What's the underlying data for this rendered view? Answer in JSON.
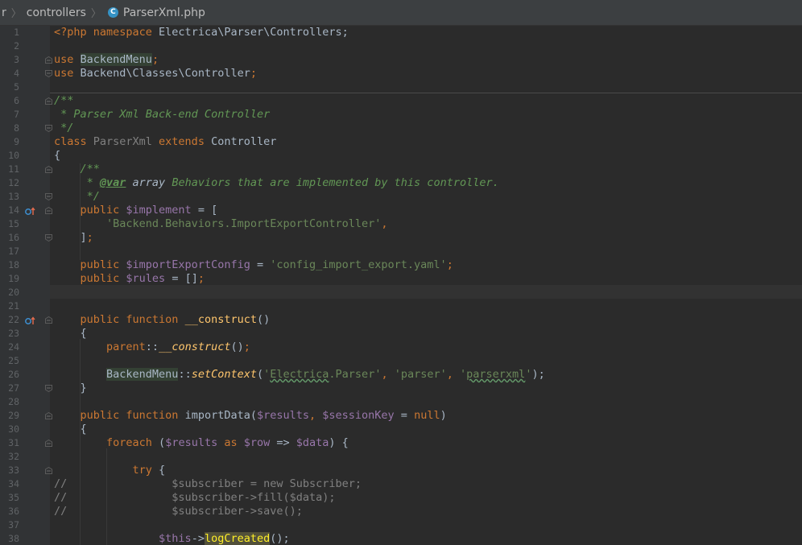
{
  "breadcrumb": {
    "partial": "r",
    "folder": "controllers",
    "file": "ParserXml.php",
    "file_icon_letter": "C"
  },
  "lines": [
    {
      "n": "1"
    },
    {
      "n": "2"
    },
    {
      "n": "3"
    },
    {
      "n": "4"
    },
    {
      "n": "5"
    },
    {
      "n": "6"
    },
    {
      "n": "7"
    },
    {
      "n": "8"
    },
    {
      "n": "9"
    },
    {
      "n": "10"
    },
    {
      "n": "11"
    },
    {
      "n": "12"
    },
    {
      "n": "13"
    },
    {
      "n": "14"
    },
    {
      "n": "15"
    },
    {
      "n": "16"
    },
    {
      "n": "17"
    },
    {
      "n": "18"
    },
    {
      "n": "19"
    },
    {
      "n": "20"
    },
    {
      "n": "21"
    },
    {
      "n": "22"
    },
    {
      "n": "23"
    },
    {
      "n": "24"
    },
    {
      "n": "25"
    },
    {
      "n": "26"
    },
    {
      "n": "27"
    },
    {
      "n": "28"
    },
    {
      "n": "29"
    },
    {
      "n": "30"
    },
    {
      "n": "31"
    },
    {
      "n": "32"
    },
    {
      "n": "33"
    },
    {
      "n": "34"
    },
    {
      "n": "35"
    },
    {
      "n": "36"
    },
    {
      "n": "37"
    },
    {
      "n": "38"
    }
  ],
  "tokens": {
    "l1_a": "<?php namespace",
    "l1_b": " Electrica\\Parser\\Controllers;",
    "l3_a": "use",
    "l3_b": "BackendMenu",
    "l3_c": ";",
    "l4_a": "use",
    "l4_b": " Backend\\Classes\\Controller",
    "l4_c": ";",
    "l6": "/**",
    "l7": " * Parser Xml Back-end Controller",
    "l8": " */",
    "l9_a": "class",
    "l9_b": " ParserXml ",
    "l9_c": "extends",
    "l9_d": " Controller",
    "l10": "{",
    "l11": "    /**",
    "l12_a": "     * ",
    "l12_b": "@var",
    "l12_c": " array",
    "l12_d": " Behaviors that are implemented by this controller.",
    "l13": "     */",
    "l14_a": "    public ",
    "l14_b": "$implement",
    "l14_c": " = [",
    "l15": "        'Backend.Behaviors.ImportExportController'",
    "l15_b": ",",
    "l16_a": "    ]",
    "l16_b": ";",
    "l18_a": "    public ",
    "l18_b": "$importExportConfig",
    "l18_c": " = ",
    "l18_d": "'config_import_export.yaml'",
    "l18_e": ";",
    "l19_a": "    public ",
    "l19_b": "$rules",
    "l19_c": " = []",
    "l19_d": ";",
    "l22_a": "    public function ",
    "l22_b": "__construct",
    "l22_c": "()",
    "l23": "    {",
    "l24_a": "        parent",
    "l24_b": "::",
    "l24_c": "__construct",
    "l24_d": "()",
    "l24_e": ";",
    "l26_a": "        ",
    "l26_b": "BackendMenu",
    "l26_c": "::",
    "l26_d": "setContext",
    "l26_e": "(",
    "l26_f": "'",
    "l26_g": "Electrica",
    "l26_h": ".Parser'",
    "l26_i": ", ",
    "l26_j": "'parser'",
    "l26_k": ", ",
    "l26_l": "'",
    "l26_m": "parserxml",
    "l26_n": "'",
    "l26_o": ");",
    "l27": "    }",
    "l29_a": "    public function ",
    "l29_b": "importData(",
    "l29_c": "$results",
    "l29_d": ", ",
    "l29_e": "$sessionKey",
    "l29_f": " = ",
    "l29_g": "null",
    "l29_h": ")",
    "l30": "    {",
    "l31_a": "        foreach ",
    "l31_b": "(",
    "l31_c": "$results",
    "l31_d": " as ",
    "l31_e": "$row",
    "l31_f": " => ",
    "l31_g": "$data",
    "l31_h": ") {",
    "l33_a": "            try ",
    "l33_b": "{",
    "l34": "//                $subscriber = new Subscriber;",
    "l35": "//                $subscriber->fill($data);",
    "l36": "//                $subscriber->save();",
    "l38_a": "                ",
    "l38_b": "$this",
    "l38_c": "->",
    "l38_d": "logCreated",
    "l38_e": "();"
  },
  "colors": {
    "background": "#2b2b2b",
    "gutter": "#313335",
    "keyword": "#cc7832",
    "string": "#6a8759",
    "variable": "#9876aa",
    "doc_comment": "#629755",
    "function": "#ffc66d",
    "text": "#a9b7c6"
  }
}
